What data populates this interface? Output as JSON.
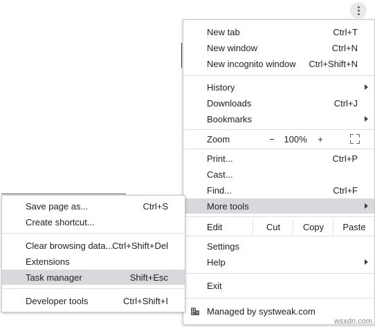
{
  "main_menu": {
    "items": [
      {
        "label": "New tab",
        "shortcut": "Ctrl+T"
      },
      {
        "label": "New window",
        "shortcut": "Ctrl+N"
      },
      {
        "label": "New incognito window",
        "shortcut": "Ctrl+Shift+N"
      },
      {
        "label": "History",
        "shortcut": ""
      },
      {
        "label": "Downloads",
        "shortcut": "Ctrl+J"
      },
      {
        "label": "Bookmarks",
        "shortcut": ""
      },
      {
        "label": "Print...",
        "shortcut": "Ctrl+P"
      },
      {
        "label": "Cast...",
        "shortcut": ""
      },
      {
        "label": "Find...",
        "shortcut": "Ctrl+F"
      },
      {
        "label": "More tools",
        "shortcut": ""
      },
      {
        "label": "Settings",
        "shortcut": ""
      },
      {
        "label": "Help",
        "shortcut": ""
      },
      {
        "label": "Exit",
        "shortcut": ""
      }
    ],
    "zoom": {
      "label": "Zoom",
      "minus": "−",
      "value": "100%",
      "plus": "+"
    },
    "edit": {
      "label": "Edit",
      "cut": "Cut",
      "copy": "Copy",
      "paste": "Paste"
    },
    "managed": {
      "label": "Managed by systweak.com"
    }
  },
  "more_tools_submenu": {
    "items": [
      {
        "label": "Save page as...",
        "shortcut": "Ctrl+S"
      },
      {
        "label": "Create shortcut...",
        "shortcut": ""
      },
      {
        "label": "Clear browsing data...",
        "shortcut": "Ctrl+Shift+Del"
      },
      {
        "label": "Extensions",
        "shortcut": ""
      },
      {
        "label": "Task manager",
        "shortcut": "Shift+Esc"
      },
      {
        "label": "Developer tools",
        "shortcut": "Ctrl+Shift+I"
      }
    ]
  },
  "watermark": "wsxdn.com",
  "highlight_color": "#d9d9dd"
}
